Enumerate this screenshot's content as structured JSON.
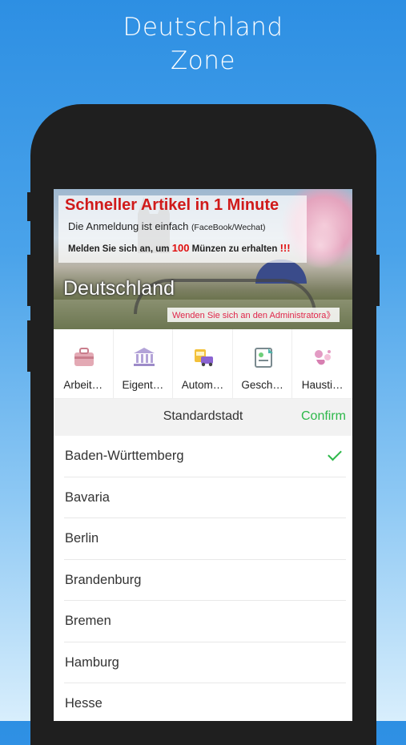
{
  "promo": {
    "line1": "Deutschland",
    "line2": "Zone"
  },
  "banner": {
    "title": "Schneller Artikel in 1 Minute",
    "subtitle": "Die Anmeldung ist einfach",
    "subtitle_small": "(FaceBook/Wechat)",
    "coins_prefix": "Melden Sie sich an, um",
    "coins_amount": "100",
    "coins_suffix": "Münzen zu erhalten",
    "coins_mark": "!!!",
    "country": "Deutschland",
    "admin_link": "Wenden Sie sich an den Administratora》"
  },
  "categories": [
    {
      "label": "Arbeit…",
      "icon": "briefcase-icon"
    },
    {
      "label": "Eigent…",
      "icon": "bank-icon"
    },
    {
      "label": "Autom…",
      "icon": "car-icon"
    },
    {
      "label": "Gesch…",
      "icon": "business-card-icon"
    },
    {
      "label": "Hausti…",
      "icon": "pet-icon"
    }
  ],
  "picker": {
    "title": "Standardstadt",
    "confirm": "Confirm"
  },
  "states": [
    {
      "name": "Baden-Württemberg",
      "selected": true
    },
    {
      "name": "Bavaria",
      "selected": false
    },
    {
      "name": "Berlin",
      "selected": false
    },
    {
      "name": "Brandenburg",
      "selected": false
    },
    {
      "name": "Bremen",
      "selected": false
    },
    {
      "name": "Hamburg",
      "selected": false
    },
    {
      "name": "Hesse",
      "selected": false
    }
  ],
  "colors": {
    "accent_green": "#2db84a",
    "title_red": "#d01a1a",
    "phone_frame": "#1f1f1f"
  }
}
